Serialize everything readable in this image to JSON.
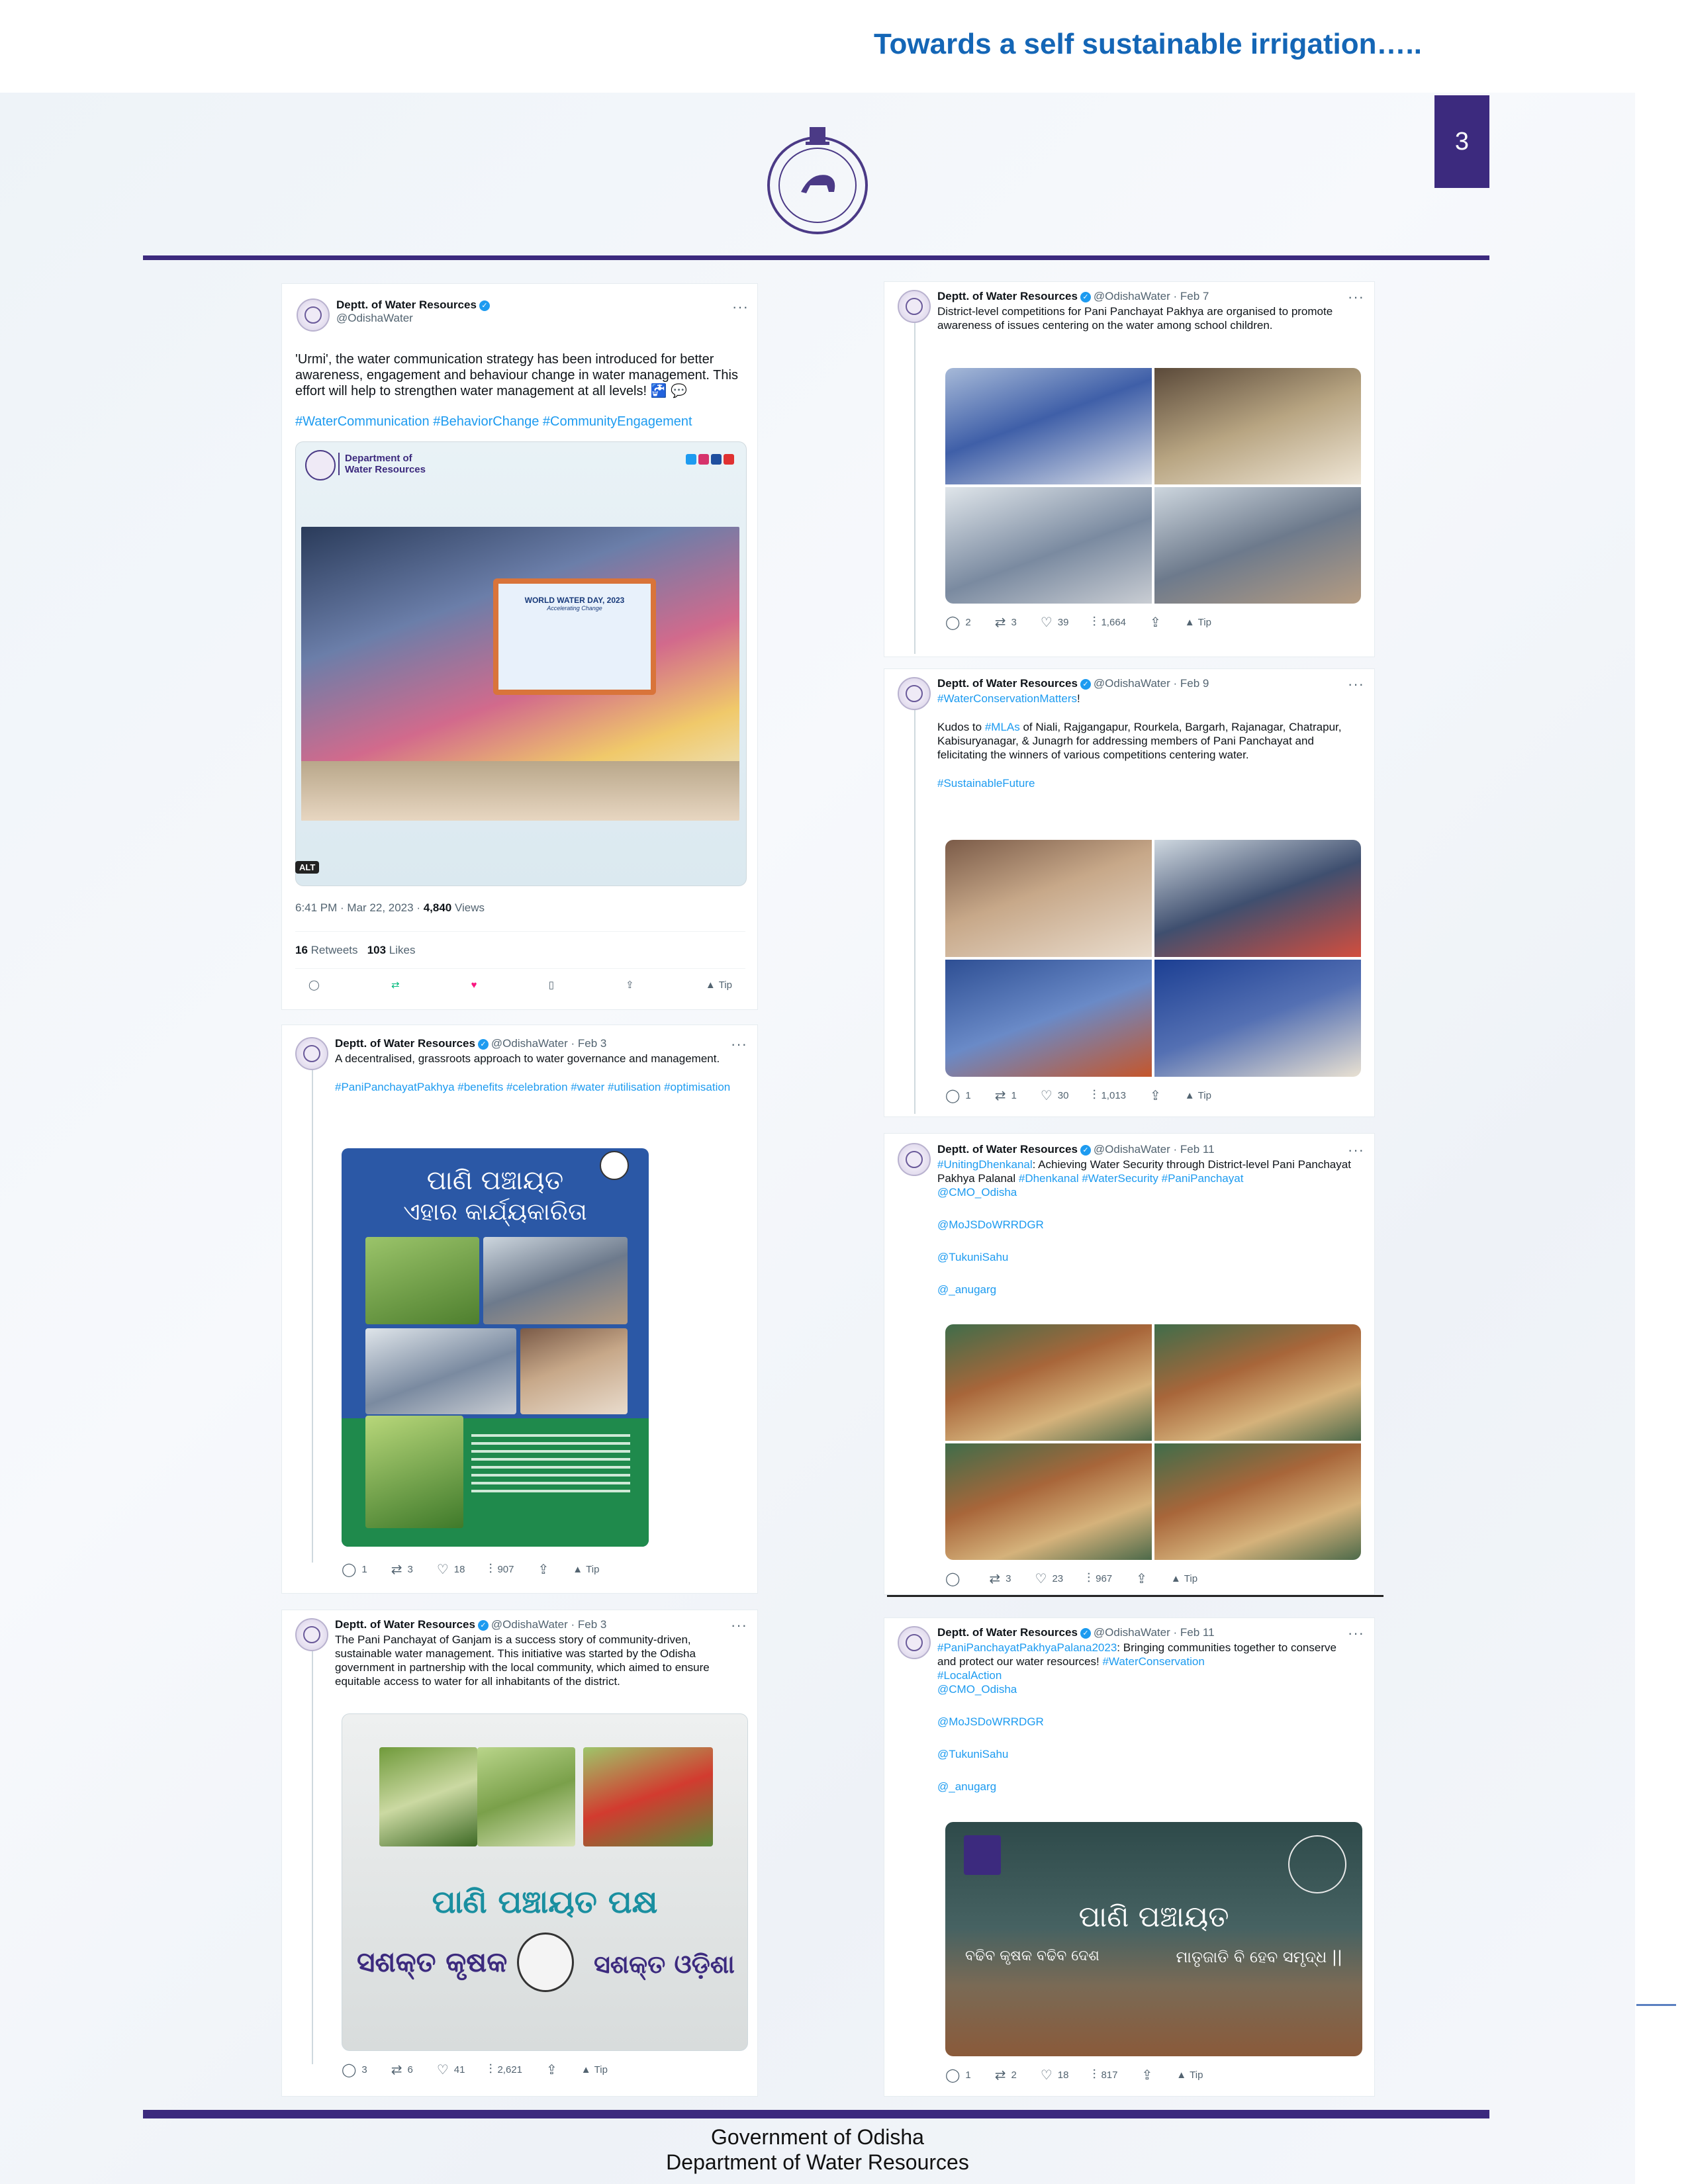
{
  "header": {
    "title": "Towards a self sustainable irrigation….."
  },
  "page_number": "3",
  "footer": {
    "line1": "Government of Odisha",
    "line2": "Department of Water Resources"
  },
  "tweets": [
    {
      "name": "Deptt. of Water Resources",
      "handle": "@OdishaWater",
      "date": "",
      "text": "'Urmi', the water communication strategy has been introduced for better awareness, engagement and behaviour change in water management. This effort will help to strengthen water management at all levels! 🚰 💬",
      "hashtags": "#WaterCommunication #BehaviorChange #CommunityEngagement",
      "card_dept_line1": "Department of",
      "card_dept_line2": "Water Resources",
      "banner_text": "WORLD WATER DAY, 2023",
      "banner_sub": "Accelerating Change",
      "alt_badge": "ALT",
      "timestamp": "6:41 PM · Mar 22, 2023 · ",
      "views_num": "4,840",
      "views_label": " Views",
      "retweets_num": "16",
      "retweets_label": " Retweets",
      "likes_num": "103",
      "likes_label": " Likes",
      "tip": "Tip"
    },
    {
      "name": "Deptt. of Water Resources",
      "handle": "@OdishaWater · Feb 7",
      "text": "District-level competitions for Pani Panchayat Pakhya are organised to promote awareness of issues centering on the water among school children.",
      "replies": "2",
      "retweets": "3",
      "likes": "39",
      "views": "1,664",
      "tip": "Tip"
    },
    {
      "name": "Deptt. of Water Resources",
      "handle": "@OdishaWater · Feb 9",
      "hashtag_top": "#WaterConservationMatters",
      "text_pre": "Kudos to ",
      "mention": "#MLAs",
      "text": " of Niali, Rajgangapur, Rourkela, Bargarh, Rajanagar, Chatrapur, Kabisuryanagar, & Junagrh for addressing members of Pani Panchayat and felicitating the winners of various competitions centering water.",
      "hashtag_bottom": "#SustainableFuture",
      "replies": "1",
      "retweets": "1",
      "likes": "30",
      "views": "1,013",
      "tip": "Tip"
    },
    {
      "name": "Deptt. of Water Resources",
      "handle": "@OdishaWater · Feb 3",
      "text": "A decentralised, grassroots approach to water governance and management.",
      "hashtags": "#PaniPanchayatPakhya #benefits #celebration #water #utilisation #optimisation",
      "poster_title1": "ପାଣି ପଞ୍ଚାୟତ",
      "poster_title2": "ଏହାର କାର୍ଯ୍ୟକାରିତା",
      "replies": "1",
      "retweets": "3",
      "likes": "18",
      "views": "907",
      "tip": "Tip"
    },
    {
      "name": "Deptt. of Water Resources",
      "handle": "@OdishaWater · Feb 11",
      "text_tag": "#UnitingDhenkanal",
      "text": ": Achieving Water Security through District-level Pani Panchayat Pakhya Palanal ",
      "text_tags2": "#Dhenkanal #WaterSecurity #PaniPanchayat",
      "mentions": [
        "@CMO_Odisha",
        "@MoJSDoWRRDGR",
        "@TukuniSahu",
        "@_anugarg"
      ],
      "replies": "",
      "retweets": "3",
      "likes": "23",
      "views": "967",
      "tip": "Tip"
    },
    {
      "name": "Deptt. of Water Resources",
      "handle": "@OdishaWater · Feb 3",
      "text": "The Pani Panchayat of Ganjam is a success story of community-driven, sustainable water management. This initiative was started by the Odisha government in partnership with the local community, which aimed to ensure equitable access to water for all inhabitants of the district.",
      "poster_title": "ପାଣି ପଞ୍ଚାୟତ ପକ୍ଷ",
      "poster_left": "ସଶକ୍ତ କୃଷକ",
      "poster_right": "ସଶକ୍ତ ଓଡ଼ିଶା",
      "replies": "3",
      "retweets": "6",
      "likes": "41",
      "views": "2,621",
      "tip": "Tip"
    },
    {
      "name": "Deptt. of Water Resources",
      "handle": "@OdishaWater · Feb 11",
      "text_tag": "#PaniPanchayatPakhyaPalana2023",
      "text": ": Bringing communities together to conserve and protect our water resources! ",
      "text_tags2": "#WaterConservation",
      "tag_line2": "#LocalAction",
      "mentions": [
        "@CMO_Odisha",
        "@MoJSDoWRRDGR",
        "@TukuniSahu",
        "@_anugarg"
      ],
      "poster_title": "ପାଣି ପଞ୍ଚାୟତ",
      "poster_left": "ବଢିବ କୃଷକ ବଢିବ ଦେଶ",
      "poster_right": "ମାତୃଜାତି ବି ହେବ ସମୃଦ୍ଧ ||",
      "replies": "1",
      "retweets": "2",
      "likes": "18",
      "views": "817",
      "tip": "Tip"
    }
  ],
  "colors": {
    "accent": "#3c2a7e",
    "header_blue": "#1466b6",
    "link": "#1d9bf0",
    "like_red": "#f91880",
    "retweet_green": "#00ba7c"
  }
}
